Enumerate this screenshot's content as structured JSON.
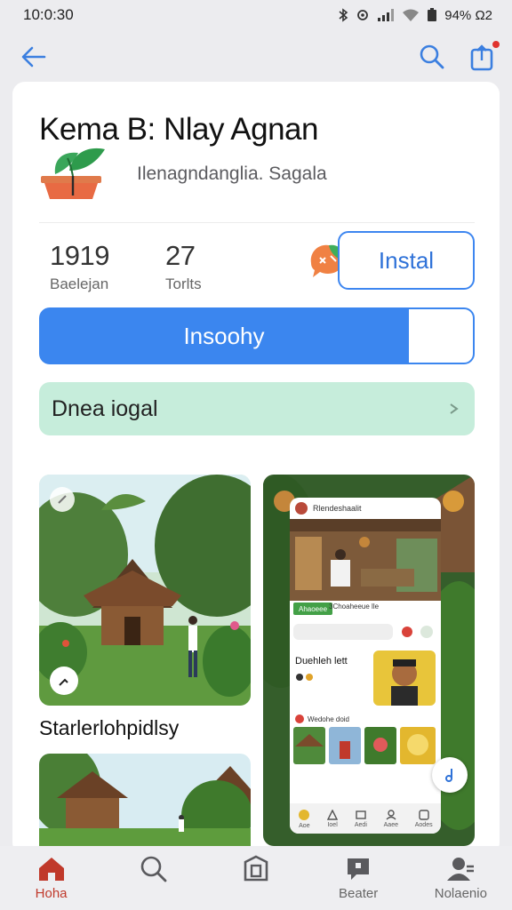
{
  "status_bar": {
    "time": "10:0:30",
    "battery": "94% Ω2"
  },
  "app": {
    "title": "Kema B: Nlay Agnan",
    "developer": "Ilenagndanglia. Sagala",
    "logo_icon": "potted-plant-icon",
    "stats": [
      {
        "value": "1919",
        "label": "Baelejan"
      },
      {
        "value": "27",
        "label": "Torlts"
      }
    ],
    "install_label": "Instal",
    "primary_label": "Insoohy",
    "info_label": "Dnea iogal"
  },
  "gallery": {
    "caption": "Starlerlohpidlsy",
    "mock": {
      "header": "Rlendeshaalit",
      "tag": "Ahaoeee",
      "tag_text": "3Choaheeue lle",
      "title": "Duehleh lett",
      "list_title": "Wedohe doid",
      "nav": [
        "Aoe",
        "Ioel",
        "Aedi",
        "Aaee",
        "Aodes"
      ]
    }
  },
  "bottom_nav": [
    {
      "label": "Hoha",
      "icon": "home-icon",
      "active": true
    },
    {
      "label": "",
      "icon": "search-icon",
      "active": false
    },
    {
      "label": "",
      "icon": "library-icon",
      "active": false
    },
    {
      "label": "Beater",
      "icon": "chat-icon",
      "active": false
    },
    {
      "label": "Nolaenio",
      "icon": "profile-icon",
      "active": false
    }
  ],
  "colors": {
    "accent": "#3b86ef",
    "banner": "#c6eddb",
    "active_nav": "#c0392b"
  }
}
